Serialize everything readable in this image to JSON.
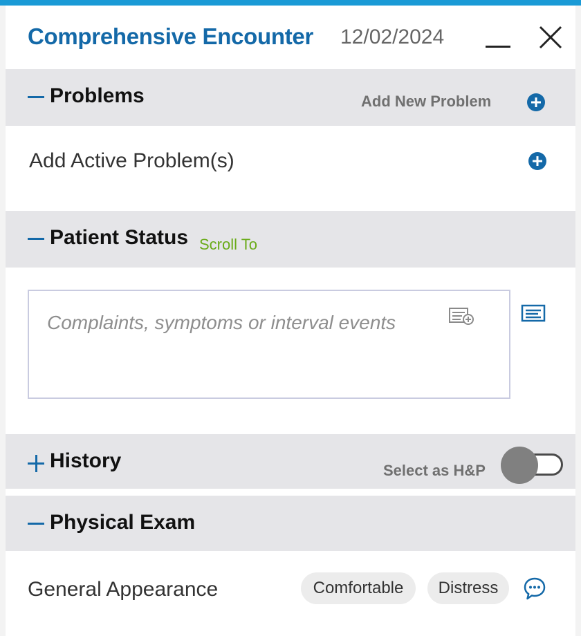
{
  "header": {
    "title": "Comprehensive Encounter",
    "date": "12/02/2024"
  },
  "sections": {
    "problems": {
      "title": "Problems",
      "action_label": "Add New Problem",
      "row_label": "Add Active Problem(s)"
    },
    "patient_status": {
      "title": "Patient Status",
      "link_label": "Scroll To",
      "placeholder": "Complaints, symptoms or interval events"
    },
    "history": {
      "title": "History",
      "toggle_label": "Select as H&P",
      "toggle_on": false
    },
    "physical_exam": {
      "title": "Physical Exam",
      "row_label": "General Appearance",
      "options": [
        "Comfortable",
        "Distress"
      ]
    }
  },
  "icons": {
    "minimize": "minimize-icon",
    "close": "close-icon",
    "add": "plus-circle-icon",
    "template_add": "template-add-icon",
    "template": "template-icon",
    "comment": "chat-bubble-icon"
  },
  "colors": {
    "accent": "#1469a8",
    "top_bar": "#1a9ad6",
    "section_bg": "#e5e5e8",
    "link_green": "#6aab19",
    "muted_text": "#707070"
  }
}
